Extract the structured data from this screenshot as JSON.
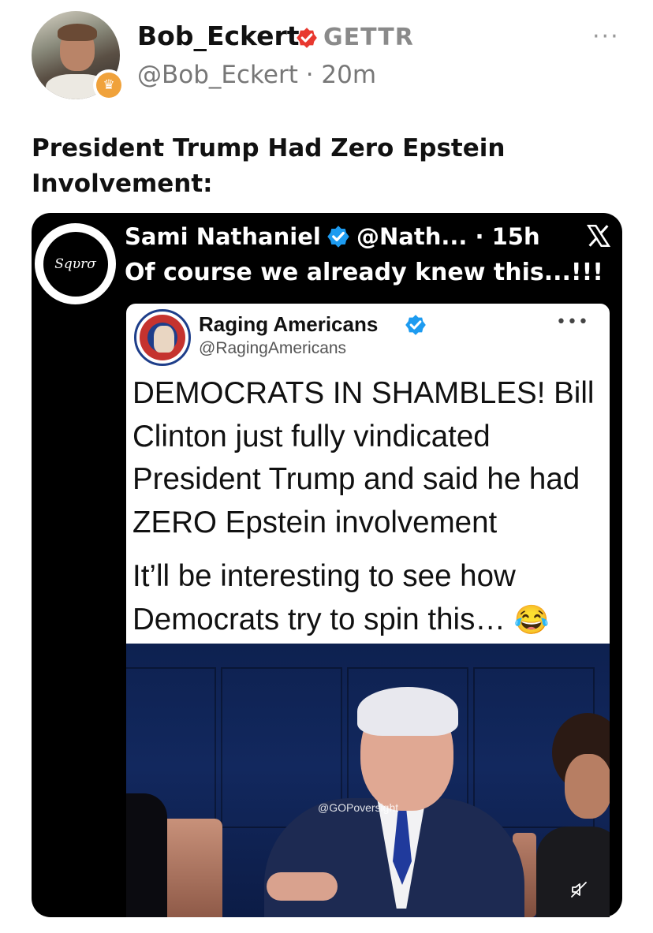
{
  "post": {
    "display_name": "Bob_Eckert",
    "platform_label": "GETTR",
    "handle_time": "@Bob_Eckert · 20m",
    "text": "President Trump Had Zero Epstein Involvement:",
    "more_label": "···"
  },
  "embedded": {
    "avatar_text": "Sqυrσ",
    "name": "Sami Nathaniel",
    "handle_time": "@Nath... · 15h",
    "text": "Of course we already knew this...!!!",
    "quoted": {
      "name": "Raging Americans",
      "handle": "@RagingAmericans",
      "more_label": "•••",
      "paragraph1": "DEMOCRATS IN SHAMBLES! Bill Clinton just fully vindicated President Trump and said he had ZERO Epstein involvement",
      "paragraph2": "It’ll be interesting to see how Democrats try to spin this…",
      "emoji": "😂"
    },
    "video": {
      "watermark": "@GOPoversight"
    }
  },
  "colors": {
    "verified_red": "#e8382f",
    "verified_blue": "#1d9bf0",
    "accent_gold": "#f0a23b"
  },
  "icons": [
    "crown-icon",
    "verified-red-icon",
    "more-icon",
    "verified-blue-icon",
    "x-logo-icon",
    "mute-icon"
  ]
}
